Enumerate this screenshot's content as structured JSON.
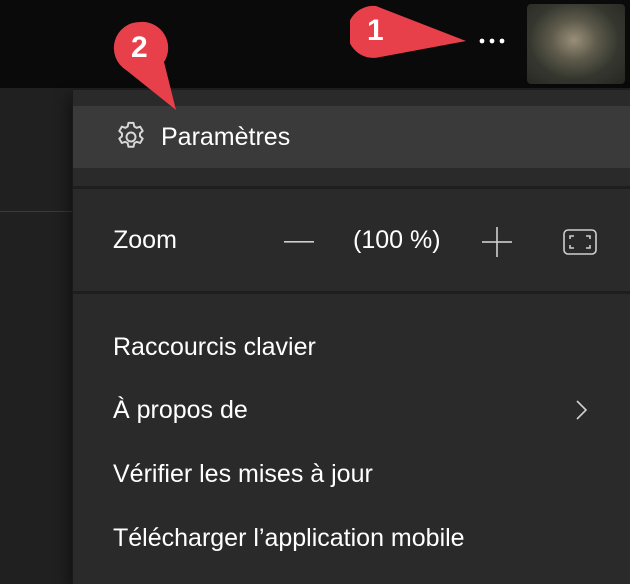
{
  "menu": {
    "settings_label": "Paramètres",
    "zoom": {
      "label": "Zoom",
      "value": "(100 %)"
    },
    "items": [
      "Raccourcis clavier",
      "À propos de",
      "Vérifier les mises à jour",
      "Télécharger l’application mobile"
    ]
  },
  "annotations": {
    "one": "1",
    "two": "2"
  },
  "icons": [
    "more-options-icon",
    "gear-icon",
    "zoom-out-icon",
    "zoom-in-icon",
    "fullscreen-icon",
    "chevron-right-icon"
  ],
  "colors": {
    "annotation_red": "#e8404a",
    "menu_bg": "#2a2a2a",
    "menu_hover": "#3a3a3a"
  }
}
